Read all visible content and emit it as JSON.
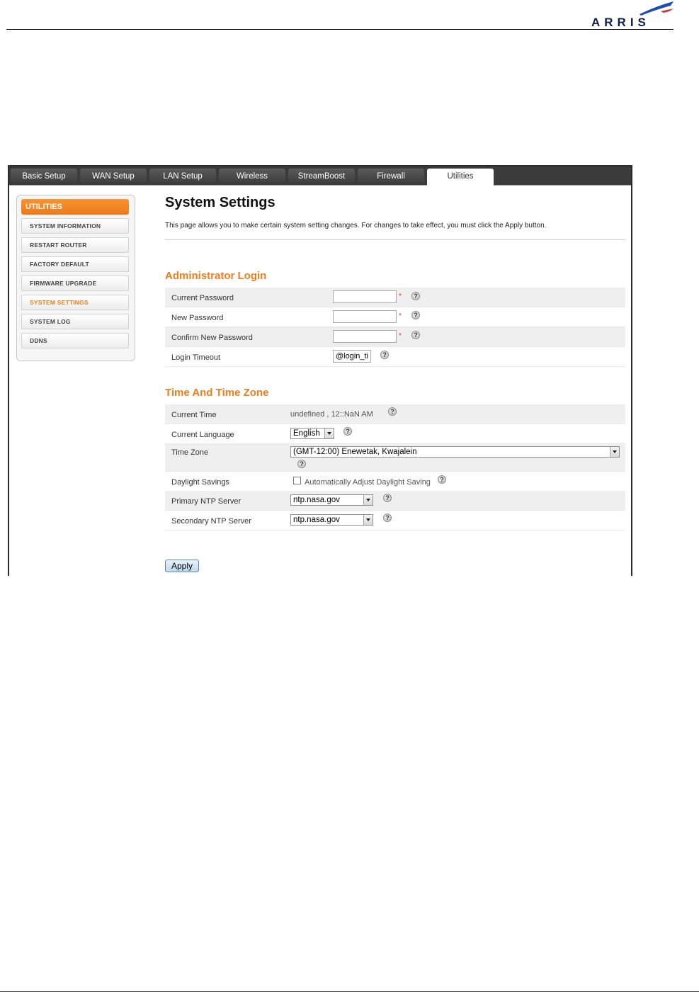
{
  "logo": {
    "text": "ARRIS",
    "accent": "#1b4db3"
  },
  "tabs": [
    {
      "label": "Basic Setup",
      "active": false
    },
    {
      "label": "WAN Setup",
      "active": false
    },
    {
      "label": "LAN Setup",
      "active": false
    },
    {
      "label": "Wireless",
      "active": false
    },
    {
      "label": "StreamBoost",
      "active": false
    },
    {
      "label": "Firewall",
      "active": false
    },
    {
      "label": "Utilities",
      "active": true
    }
  ],
  "sidebar": {
    "header": "UTILITIES",
    "items": [
      {
        "label": "SYSTEM INFORMATION",
        "active": false
      },
      {
        "label": "RESTART ROUTER",
        "active": false
      },
      {
        "label": "FACTORY DEFAULT",
        "active": false
      },
      {
        "label": "FIRMWARE UPGRADE",
        "active": false
      },
      {
        "label": "SYSTEM SETTINGS",
        "active": true
      },
      {
        "label": "SYSTEM LOG",
        "active": false
      },
      {
        "label": "DDNS",
        "active": false
      }
    ]
  },
  "page": {
    "title": "System Settings",
    "description": "This page allows you to make certain system setting changes. For changes to take effect, you must click the Apply button."
  },
  "admin_login": {
    "title": "Administrator Login",
    "current_password_label": "Current Password",
    "current_password_value": "",
    "new_password_label": "New Password",
    "new_password_value": "",
    "confirm_password_label": "Confirm New Password",
    "confirm_password_value": "",
    "required_mark": "*",
    "login_timeout_label": "Login Timeout",
    "login_timeout_value": "@login_ti"
  },
  "time_zone": {
    "title": "Time And Time Zone",
    "current_time_label": "Current Time",
    "current_time_value": "undefined ,   12::NaN AM",
    "current_language_label": "Current Language",
    "current_language_value": "English",
    "time_zone_label": "Time Zone",
    "time_zone_value": "(GMT-12:00) Enewetak, Kwajalein",
    "daylight_label": "Daylight Savings",
    "daylight_checkbox_label": "Automatically Adjust Daylight Saving",
    "daylight_checked": false,
    "primary_ntp_label": "Primary NTP Server",
    "primary_ntp_value": "ntp.nasa.gov",
    "secondary_ntp_label": "Secondary NTP Server",
    "secondary_ntp_value": "ntp.nasa.gov"
  },
  "help_glyph": "?",
  "apply_label": "Apply",
  "colors": {
    "accent_orange": "#ef7d1c",
    "tab_bar": "#3b3b3b"
  }
}
